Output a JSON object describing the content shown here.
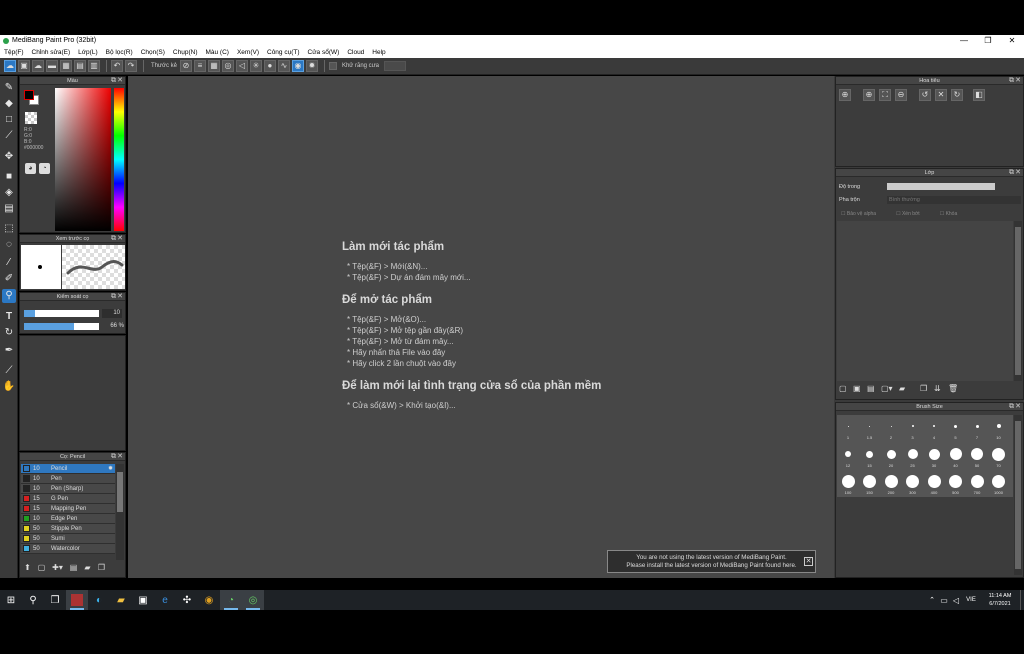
{
  "window": {
    "title": "MediBang Paint Pro (32bit)",
    "controls": [
      "—",
      "❐",
      "✕"
    ]
  },
  "menu": [
    "Tệp(F)",
    "Chỉnh sửa(E)",
    "Lớp(L)",
    "Bộ lọc(R)",
    "Chọn(S)",
    "Chụp(N)",
    "Màu (C)",
    "Xem(V)",
    "Công cụ(T)",
    "Cửa sổ(W)",
    "Cloud",
    "Help"
  ],
  "toolbar": {
    "ruler_label": "Thước kẻ",
    "antialias_label": "Khử răng cưa"
  },
  "color_panel": {
    "title": "Màu",
    "r": "R:0",
    "g": "G:0",
    "b": "B:0",
    "hex": "#000000",
    "fg_color": "#000000",
    "bg_color": "#ffffff"
  },
  "preview_panel": {
    "title": "Xem trước cọ"
  },
  "brush_control_panel": {
    "title": "Kiểm soát cọ",
    "size_value": "10",
    "opacity_value": "66 %",
    "size_fraction": 0.15,
    "opacity_fraction": 0.66
  },
  "brush_list_panel": {
    "title": "Cọ: Pencil",
    "items": [
      {
        "size": "10",
        "name": "Pencil",
        "color": "#2f78c0",
        "selected": true
      },
      {
        "size": "10",
        "name": "Pen",
        "color": "#222222",
        "selected": false
      },
      {
        "size": "10",
        "name": "Pen (Sharp)",
        "color": "#222222",
        "selected": false
      },
      {
        "size": "15",
        "name": "G Pen",
        "color": "#d42020",
        "selected": false
      },
      {
        "size": "15",
        "name": "Mapping Pen",
        "color": "#d42020",
        "selected": false
      },
      {
        "size": "10",
        "name": "Edge Pen",
        "color": "#20a020",
        "selected": false
      },
      {
        "size": "50",
        "name": "Stipple Pen",
        "color": "#e0d020",
        "selected": false
      },
      {
        "size": "50",
        "name": "Sumi",
        "color": "#e0d020",
        "selected": false
      },
      {
        "size": "50",
        "name": "Watercolor",
        "color": "#40b0e0",
        "selected": false
      }
    ]
  },
  "welcome": {
    "new_heading": "Làm mới tác phẩm",
    "new_items": [
      "* Tệp(&F) > Mới(&N)...",
      "* Tệp(&F) > Dự án đám mây mới..."
    ],
    "open_heading": "Để mở tác phẩm",
    "open_items": [
      "* Tệp(&F) > Mở(&O)...",
      "* Tệp(&F) > Mở tệp gần đây(&R)",
      "* Tệp(&F) > Mở từ đám mây...",
      "* Hãy nhấn thả File vào đây",
      "* Hãy click 2 lần chuột vào đây"
    ],
    "reset_heading": "Để làm mới lại tình trạng cửa sổ của phần mềm",
    "reset_items": [
      "* Cửa sổ(&W) > Khởi tạo(&I)..."
    ]
  },
  "navigator_panel": {
    "title": "Hoa tiêu"
  },
  "layer_panel": {
    "title": "Lớp",
    "opacity_label": "Độ trong",
    "blend_label": "Pha trộn",
    "blend_value": "Bình thường",
    "protect_alpha": "Bảo vệ alpha",
    "clipping": "Xén bớt",
    "lock": "Khóa"
  },
  "brush_size_panel": {
    "title": "Brush Size",
    "row1": [
      "1",
      "1.5",
      "2",
      "3",
      "4",
      "5",
      "7",
      "10"
    ],
    "row2": [
      "12",
      "15",
      "20",
      "25",
      "30",
      "40",
      "50",
      "70"
    ],
    "row3": [
      "100",
      "150",
      "200",
      "300",
      "400",
      "500",
      "700",
      "1000"
    ]
  },
  "notification": {
    "line1": "You are not using the latest version of MediBang Paint.",
    "line2": "Please install the latest version of MediBang Paint found here."
  },
  "taskbar": {
    "time": "11:14 AM",
    "date": "6/7/2021",
    "lang": "VIE"
  }
}
